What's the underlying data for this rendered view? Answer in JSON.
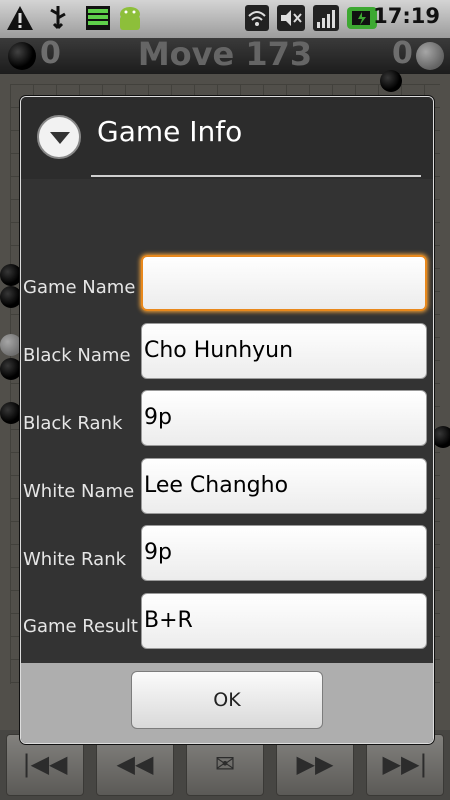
{
  "statusbar": {
    "time": "17:19"
  },
  "game": {
    "black_captures": "0",
    "white_captures": "0",
    "move_label": "Move 173"
  },
  "dialog": {
    "title": "Game Info",
    "fields": [
      {
        "label": "Game Name",
        "value": ""
      },
      {
        "label": "Black Name",
        "value": "Cho Hunhyun"
      },
      {
        "label": "Black Rank",
        "value": "9p"
      },
      {
        "label": "White Name",
        "value": "Lee Changho"
      },
      {
        "label": "White Rank",
        "value": "9p"
      },
      {
        "label": "Game Result",
        "value": "B+R"
      }
    ],
    "ok_label": "OK"
  }
}
